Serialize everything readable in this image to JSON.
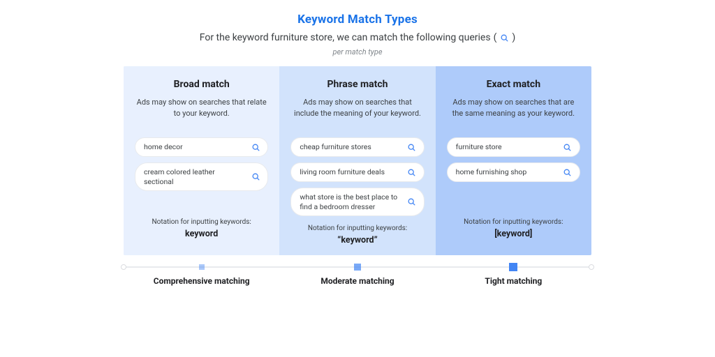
{
  "title": "Keyword Match Types",
  "subtitle_prefix": "For the keyword furniture store, we can match the following queries",
  "subtitle_paren_open": "(",
  "subtitle_paren_close": ")",
  "per_line": "per match type",
  "columns": {
    "broad": {
      "heading": "Broad match",
      "description": "Ads may show on searches that relate to your keyword.",
      "queries": [
        "home decor",
        "cream colored leather sectional"
      ],
      "notation_label": "Notation for inputting keywords:",
      "notation": "keyword"
    },
    "phrase": {
      "heading": "Phrase match",
      "description": "Ads may show on searches that include the meaning of your keyword.",
      "queries": [
        "cheap furniture stores",
        "living room furniture deals",
        "what store is the best place to find a bedroom dresser"
      ],
      "notation_label": "Notation for inputting keywords:",
      "notation": "“keyword”"
    },
    "exact": {
      "heading": "Exact match",
      "description": "Ads may show on searches that are the same meaning as your keyword.",
      "queries": [
        "furniture store",
        "home furnishing shop"
      ],
      "notation_label": "Notation for inputting keywords:",
      "notation": "[keyword]"
    }
  },
  "scale": {
    "labels": [
      "Comprehensive matching",
      "Moderate matching",
      "Tight matching"
    ]
  }
}
